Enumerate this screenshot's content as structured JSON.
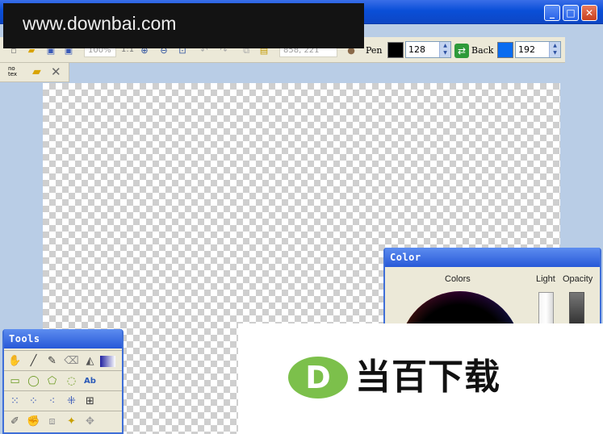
{
  "watermark": {
    "site": "www.downbai.com",
    "logo_letter": "D",
    "logo_text": "当百下载"
  },
  "window": {
    "minimize": "_",
    "maximize": "□",
    "close": "✕"
  },
  "toolbar": {
    "zoom": "100%",
    "ratio": "1:1",
    "coordinates": "858, 221",
    "pen_label": "Pen",
    "pen_color": "#000000",
    "pen_value": "128",
    "back_label": "Back",
    "back_color": "#0a6cf0",
    "back_value": "192",
    "no_tex_label": "no\ntex"
  },
  "tools_panel": {
    "title": "Tools",
    "text_tool_label": "Ab"
  },
  "color_panel": {
    "title": "Color",
    "colors_label": "Colors",
    "light_label": "Light",
    "opacity_label": "Opacity"
  }
}
